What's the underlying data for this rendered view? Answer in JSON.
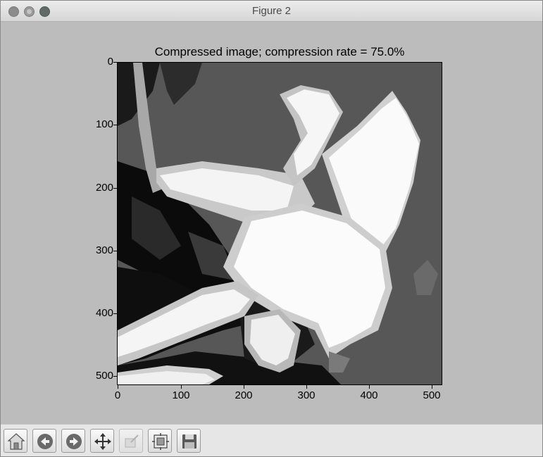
{
  "window": {
    "title": "Figure 2"
  },
  "plot": {
    "title": "Compressed image; compression rate = 75.0%",
    "y_ticks": [
      "0",
      "100",
      "200",
      "300",
      "400",
      "500"
    ],
    "x_ticks": [
      "0",
      "100",
      "200",
      "300",
      "400",
      "500"
    ]
  },
  "toolbar": {
    "buttons": [
      {
        "icon": "home-icon"
      },
      {
        "icon": "back-arrow-icon"
      },
      {
        "icon": "forward-arrow-icon"
      },
      {
        "icon": "pan-icon"
      },
      {
        "icon": "zoom-icon"
      },
      {
        "icon": "subplots-icon"
      },
      {
        "icon": "save-icon"
      }
    ]
  }
}
